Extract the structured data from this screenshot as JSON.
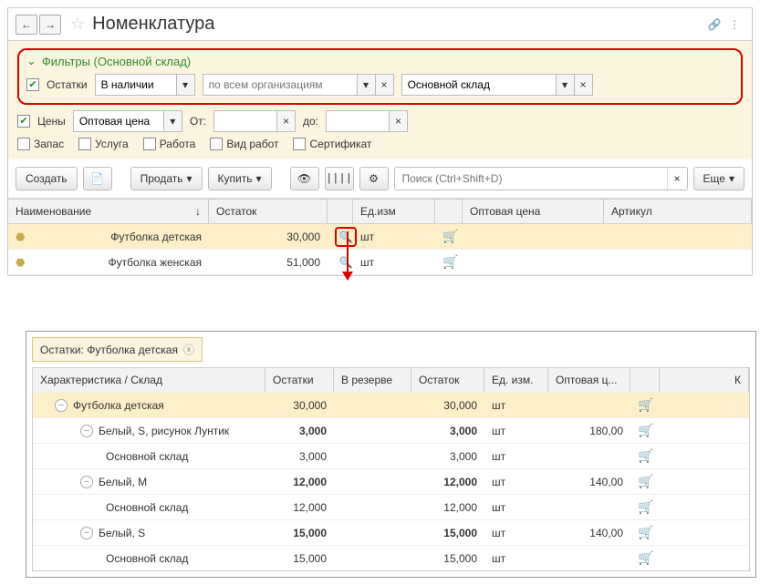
{
  "header": {
    "title": "Номенклатура"
  },
  "filters": {
    "title": "Фильтры (Основной склад)",
    "ostatki_label": "Остатки",
    "ostatki_value": "В наличии",
    "org_placeholder": "по всем организациям",
    "sklad_value": "Основной склад",
    "tseny_label": "Цены",
    "tseny_value": "Оптовая цена",
    "ot_label": "От:",
    "do_label": "до:",
    "zapas": "Запас",
    "usluga": "Услуга",
    "rabota": "Работа",
    "vidrabot": "Вид работ",
    "sert": "Сертификат"
  },
  "toolbar": {
    "create": "Создать",
    "sell": "Продать",
    "buy": "Купить",
    "search_placeholder": "Поиск (Ctrl+Shift+D)",
    "more": "Еще"
  },
  "table": {
    "cols": {
      "name": "Наименование",
      "ostatok": "Остаток",
      "unit": "Ед.изм",
      "price": "Оптовая цена",
      "art": "Артикул"
    },
    "rows": [
      {
        "name": "Футболка детская",
        "ostatok": "30,000",
        "unit": "шт",
        "selected": true,
        "mag_hl": true
      },
      {
        "name": "Футболка женская",
        "ostatok": "51,000",
        "unit": "шт",
        "selected": false,
        "mag_hl": false
      }
    ]
  },
  "detail": {
    "tab": "Остатки: Футболка детская",
    "cols": {
      "char": "Характеристика / Склад",
      "ost": "Остатки",
      "rez": "В резерве",
      "ost2": "Остаток",
      "unit": "Ед. изм.",
      "price": "Оптовая ц...",
      "k": "К"
    },
    "rows": [
      {
        "level": 1,
        "exp": "-",
        "name": "Футболка детская",
        "ost": "30,000",
        "rez": "",
        "ost2": "30,000",
        "unit": "шт",
        "price": "",
        "hl": true
      },
      {
        "level": 2,
        "exp": "-",
        "name": "Белый, S, рисунок Лунтик",
        "ost": "3,000",
        "rez": "",
        "ost2": "3,000",
        "unit": "шт",
        "price": "180,00",
        "bold": true
      },
      {
        "level": 3,
        "exp": "",
        "name": "Основной склад",
        "ost": "3,000",
        "rez": "",
        "ost2": "3,000",
        "unit": "шт",
        "price": ""
      },
      {
        "level": 2,
        "exp": "-",
        "name": "Белый, M",
        "ost": "12,000",
        "rez": "",
        "ost2": "12,000",
        "unit": "шт",
        "price": "140,00",
        "bold": true
      },
      {
        "level": 3,
        "exp": "",
        "name": "Основной склад",
        "ost": "12,000",
        "rez": "",
        "ost2": "12,000",
        "unit": "шт",
        "price": ""
      },
      {
        "level": 2,
        "exp": "-",
        "name": "Белый, S",
        "ost": "15,000",
        "rez": "",
        "ost2": "15,000",
        "unit": "шт",
        "price": "140,00",
        "bold": true
      },
      {
        "level": 3,
        "exp": "",
        "name": "Основной склад",
        "ost": "15,000",
        "rez": "",
        "ost2": "15,000",
        "unit": "шт",
        "price": ""
      }
    ]
  }
}
